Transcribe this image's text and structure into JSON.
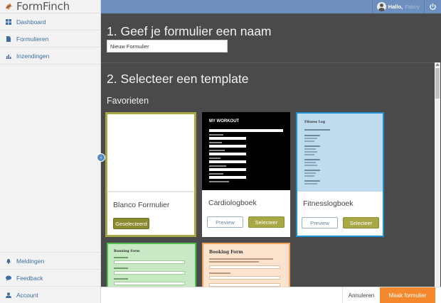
{
  "app": {
    "name": "FormFinch"
  },
  "sidebar": {
    "items": [
      {
        "label": "Dashboard",
        "icon": "dashboard-icon"
      },
      {
        "label": "Formulieren",
        "icon": "document-icon"
      },
      {
        "label": "Inzendingen",
        "icon": "chart-icon"
      }
    ],
    "bottom_items": [
      {
        "label": "Meldingen",
        "icon": "bell-icon"
      },
      {
        "label": "Feedback",
        "icon": "chat-icon"
      },
      {
        "label": "Account",
        "icon": "user-icon"
      }
    ]
  },
  "topbar": {
    "greeting": "Hallo,",
    "username": "Fabny",
    "colors": {
      "bar": "#6d8fbf"
    }
  },
  "step1": {
    "title": "1. Geef je formulier een naam",
    "input_value": "Nieuw Formulier"
  },
  "step2": {
    "title": "2. Selecteer een template",
    "section": "Favorieten"
  },
  "templates": [
    {
      "name": "Blanco Formulier",
      "selected_label": "Geselecteerd"
    },
    {
      "name": "Cardiologboek",
      "preview_label": "Preview",
      "select_label": "Selecteer",
      "thumb_title": "MY WORKOUT"
    },
    {
      "name": "Fitnesslogboek",
      "preview_label": "Preview",
      "select_label": "Selecteer",
      "thumb_title": "Fitness Log"
    },
    {
      "name": "",
      "thumb_title": "Running Form"
    },
    {
      "name": "",
      "thumb_title": "Booking Form"
    }
  ],
  "footer": {
    "cancel_label": "Annuleren",
    "create_label": "Maak formulier"
  },
  "colors": {
    "accent": "#a9a846",
    "orange": "#f5882c",
    "link": "#3f6da0"
  }
}
